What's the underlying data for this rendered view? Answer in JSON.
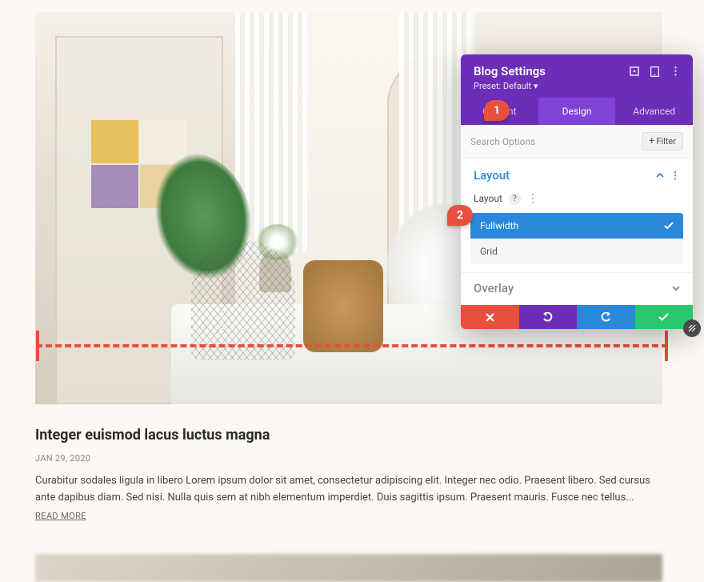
{
  "post": {
    "title": "Integer euismod lacus luctus magna",
    "date": "JAN 29, 2020",
    "excerpt": "Curabitur sodales ligula in libero Lorem ipsum dolor sit amet, consectetur adipiscing elit. Integer nec odio. Praesent libero. Sed cursus ante dapibus diam. Sed nisi. Nulla quis sem at nibh elementum imperdiet. Duis sagittis ipsum. Praesent mauris. Fusce nec tellus...",
    "read_more": "READ MORE"
  },
  "panel": {
    "title": "Blog Settings",
    "preset": "Preset: Default ▾",
    "tabs": {
      "content": "Content",
      "design": "Design",
      "advanced": "Advanced"
    },
    "search": {
      "placeholder": "Search Options",
      "filter_label": "Filter"
    },
    "sections": {
      "layout": {
        "title": "Layout",
        "label": "Layout",
        "options": {
          "fullwidth": "Fullwidth",
          "grid": "Grid"
        }
      },
      "overlay": {
        "title": "Overlay"
      }
    }
  },
  "callouts": {
    "one": "1",
    "two": "2"
  },
  "colors": {
    "purple": "#6c2eb9",
    "purple_light": "#8142d6",
    "blue": "#2b87da",
    "green": "#29c76f",
    "red": "#e94f3e"
  }
}
